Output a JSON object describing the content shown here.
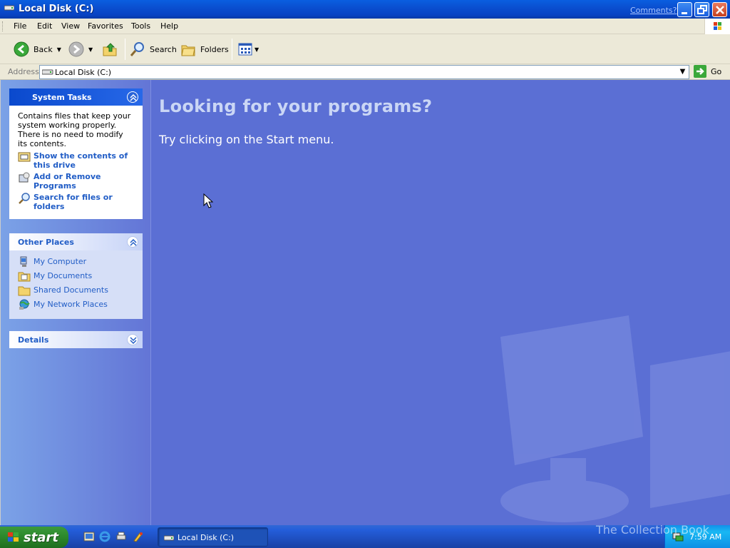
{
  "window": {
    "title": "Local Disk (C:)",
    "comments_link": "Comments?"
  },
  "menubar": {
    "items": [
      "File",
      "Edit",
      "View",
      "Favorites",
      "Tools",
      "Help"
    ]
  },
  "toolbar": {
    "back_label": "Back",
    "search_label": "Search",
    "folders_label": "Folders"
  },
  "address": {
    "label": "Address",
    "value": "Local Disk (C:)",
    "go_label": "Go"
  },
  "sidebar": {
    "system_tasks": {
      "title": "System Tasks",
      "description": "Contains files that keep your system working properly. There is no need to modify its contents.",
      "links": [
        {
          "label": "Show the contents of this drive",
          "icon": "show-contents-icon"
        },
        {
          "label": "Add or Remove Programs",
          "icon": "add-remove-programs-icon"
        },
        {
          "label": "Search for files or folders",
          "icon": "search-icon"
        }
      ]
    },
    "other_places": {
      "title": "Other Places",
      "links": [
        {
          "label": "My Computer",
          "icon": "my-computer-icon"
        },
        {
          "label": "My Documents",
          "icon": "my-documents-icon"
        },
        {
          "label": "Shared Documents",
          "icon": "shared-documents-icon"
        },
        {
          "label": "My Network Places",
          "icon": "my-network-places-icon"
        }
      ]
    },
    "details": {
      "title": "Details"
    }
  },
  "content": {
    "heading": "Looking for your programs?",
    "subheading": "Try clicking on the Start menu."
  },
  "taskbar": {
    "start_label": "start",
    "task_label": "Local Disk (C:)",
    "clock": "7:59 AM"
  },
  "watermark": "The Collection Book",
  "colors": {
    "titlebar": "#0a4fd0",
    "content_bg": "#5b6fd4",
    "link": "#215dc6",
    "start_green": "#2e8b2e"
  }
}
